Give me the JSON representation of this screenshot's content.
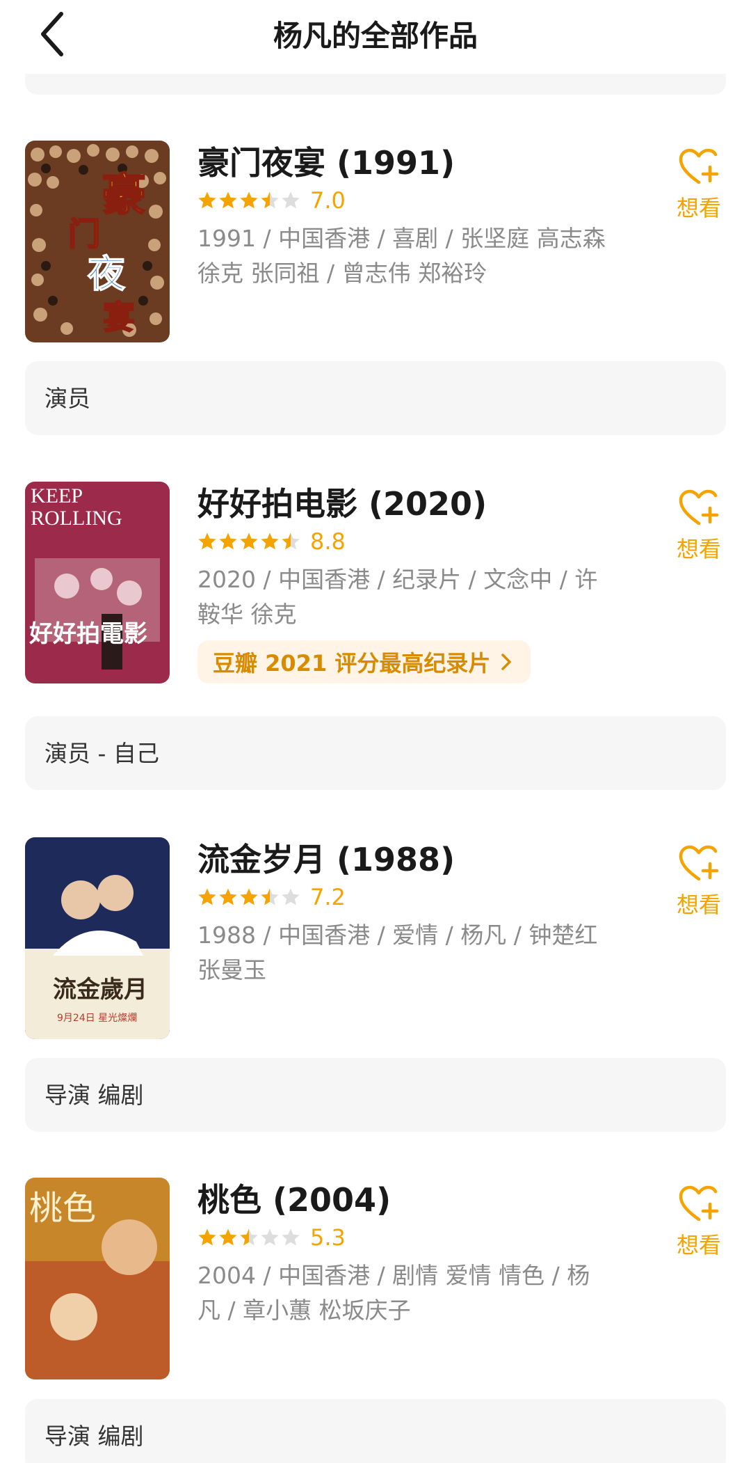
{
  "header": {
    "title": "杨凡的全部作品"
  },
  "movies": [
    {
      "title": "豪门夜宴",
      "year": "(1991)",
      "score": "7.0",
      "stars": 3.5,
      "meta": "1991 / 中国香港 / 喜剧 / 张坚庭 高志森 徐克 张同祖 / 曾志伟 郑裕玲",
      "want_label": "想看",
      "role": "演员"
    },
    {
      "title": "好好拍电影",
      "year": "(2020)",
      "score": "8.8",
      "stars": 4.5,
      "meta": "2020 / 中国香港 / 纪录片 / 文念中 / 许鞍华 徐克",
      "badge": "豆瓣 2021 评分最高纪录片",
      "want_label": "想看",
      "role": "演员 - 自己"
    },
    {
      "title": "流金岁月",
      "year": "(1988)",
      "score": "7.2",
      "stars": 3.5,
      "meta": "1988 / 中国香港 / 爱情 / 杨凡 / 钟楚红 张曼玉",
      "want_label": "想看",
      "role": "导演 编剧"
    },
    {
      "title": "桃色",
      "year": "(2004)",
      "score": "5.3",
      "stars": 2.5,
      "meta": "2004 / 中国香港 / 剧情 爱情 情色 / 杨凡 / 章小蕙 松坂庆子",
      "want_label": "想看",
      "role": "导演 编剧"
    }
  ],
  "posters": [
    {
      "text_lines": [
        "豪",
        "门",
        "夜",
        "宴"
      ]
    },
    {
      "text_lines": [
        "KEEP",
        "ROLLING",
        "好好拍電影"
      ]
    },
    {
      "text_lines": [
        "流金歲月",
        "9月24日 星光燦爛"
      ]
    },
    {
      "text_lines": [
        "桃色"
      ]
    }
  ],
  "colors": {
    "accent": "#f5a300",
    "badge_bg": "#fff4e5",
    "role_bg": "#f6f6f6"
  }
}
